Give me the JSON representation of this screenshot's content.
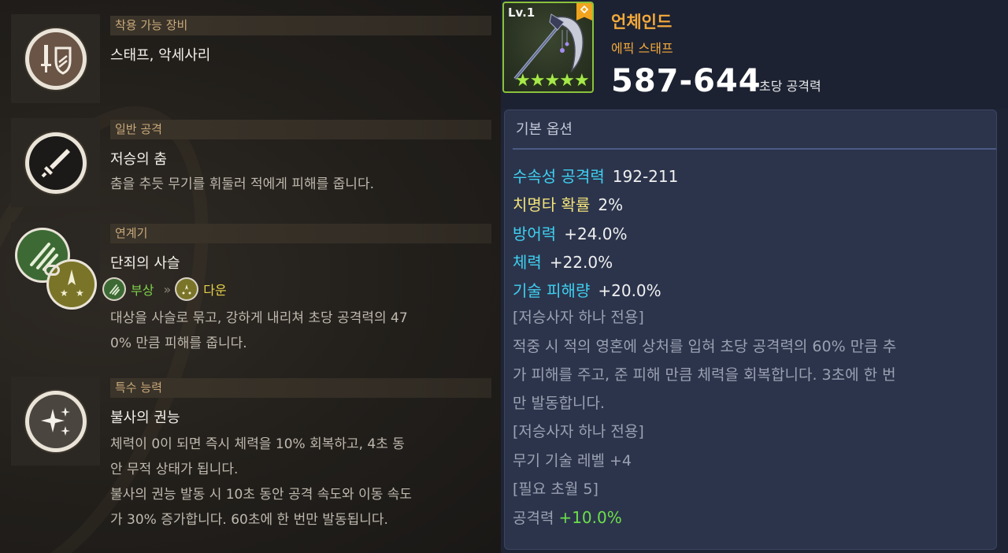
{
  "left_panel": {
    "sections": [
      {
        "header": "착용 가능 장비",
        "title": "스태프, 악세사리",
        "icon": "sword-shield-icon"
      },
      {
        "header": "일반 공격",
        "title": "저승의 춤",
        "description": "춤을 추듯 무기를 휘둘러 적에게 피해를 줍니다.",
        "icon": "sword-icon"
      },
      {
        "header": "연계기",
        "title": "단죄의 사슬",
        "tags": [
          {
            "label": "부상",
            "icon": "claw-wound-icon",
            "color": "#7ed14a"
          },
          {
            "label": "다운",
            "icon": "knockdown-icon",
            "color": "#e8d44a"
          }
        ],
        "description_line1": "대상을 사슬로 묶고, 강하게 내리쳐 초당 공격력의 47",
        "description_line2": "0% 만큼 피해를 줍니다.",
        "icon": "chain-claw-icon"
      },
      {
        "header": "특수 능력",
        "title": "불사의 권능",
        "description_lines": [
          "체력이 0이 되면 즉시 체력을 10% 회복하고, 4초 동",
          "안 무적 상태가 됩니다.",
          "불사의 권능 발동 시 10초 동안 공격 속도와 이동 속도",
          "가 30% 증가합니다. 60초에 한 번만 발동됩니다."
        ],
        "icon": "sparkle-stars-icon"
      }
    ]
  },
  "item": {
    "level": "Lv.1",
    "name": "언체인드",
    "grade": "에픽 스태프",
    "attack": "587-644",
    "attack_label": "초당 공격력",
    "stars": 5,
    "icon": "scythe-staff-icon",
    "colors": {
      "name": "#f3a93b",
      "frame": "#8ac23b",
      "star": "#a6e94a"
    }
  },
  "options": {
    "title": "기본 옵션",
    "stats": [
      {
        "key": "수속성 공격력",
        "value": "192-211",
        "key_color": "#3fd0f0"
      },
      {
        "key": "치명타 확률",
        "value": "2%",
        "key_color": "#f1e27a"
      },
      {
        "key": "방어력",
        "value": "+24.0%",
        "key_color": "#3fd0f0"
      },
      {
        "key": "체력",
        "value": "+22.0%",
        "key_color": "#3fd0f0"
      },
      {
        "key": "기술 피해량",
        "value": "+20.0%",
        "key_color": "#3fd0f0"
      }
    ],
    "reaper_note_1": "[저승사자 하나 전용]",
    "reaper_desc_lines": [
      "적중 시 적의 영혼에 상처를 입혀 초당 공격력의 60% 만큼 추",
      "가 피해를 주고, 준 피해 만큼 체력을 회복합니다. 3초에 한 번",
      "만 발동합니다."
    ],
    "reaper_note_2": "[저승사자 하나 전용]",
    "weapon_skill": "무기 기술 레벨 +4",
    "transcend_req": "[필요 초월 5]",
    "final_stat_key": "공격력",
    "final_stat_value": "+10.0%"
  }
}
